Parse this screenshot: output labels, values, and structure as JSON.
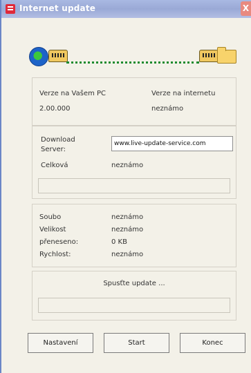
{
  "window": {
    "title": "Internet update",
    "close_glyph": "X"
  },
  "versions": {
    "local_label": "Verze na Vašem PC",
    "local_value": "2.00.000",
    "remote_label": "Verze na internetu",
    "remote_value": "neznámo"
  },
  "download": {
    "server_label": "Download Server:",
    "server_value": "www.live-update-service.com",
    "total_label": "Celková",
    "total_value": "neznámo",
    "progress": 0
  },
  "file": {
    "rows": [
      {
        "label": "Soubo",
        "value": "neznámo"
      },
      {
        "label": "Velikost",
        "value": "neznámo"
      },
      {
        "label": "přeneseno:",
        "value": "0 KB"
      },
      {
        "label": "Rychlost:",
        "value": "neznámo"
      }
    ]
  },
  "update": {
    "status": "Spusťte update ...",
    "progress": 0
  },
  "buttons": {
    "settings": "Nastavení",
    "start": "Start",
    "end": "Konec"
  },
  "icons": [
    "globe-icon",
    "phone-icon",
    "folder-icon",
    "app-icon",
    "close-icon"
  ]
}
